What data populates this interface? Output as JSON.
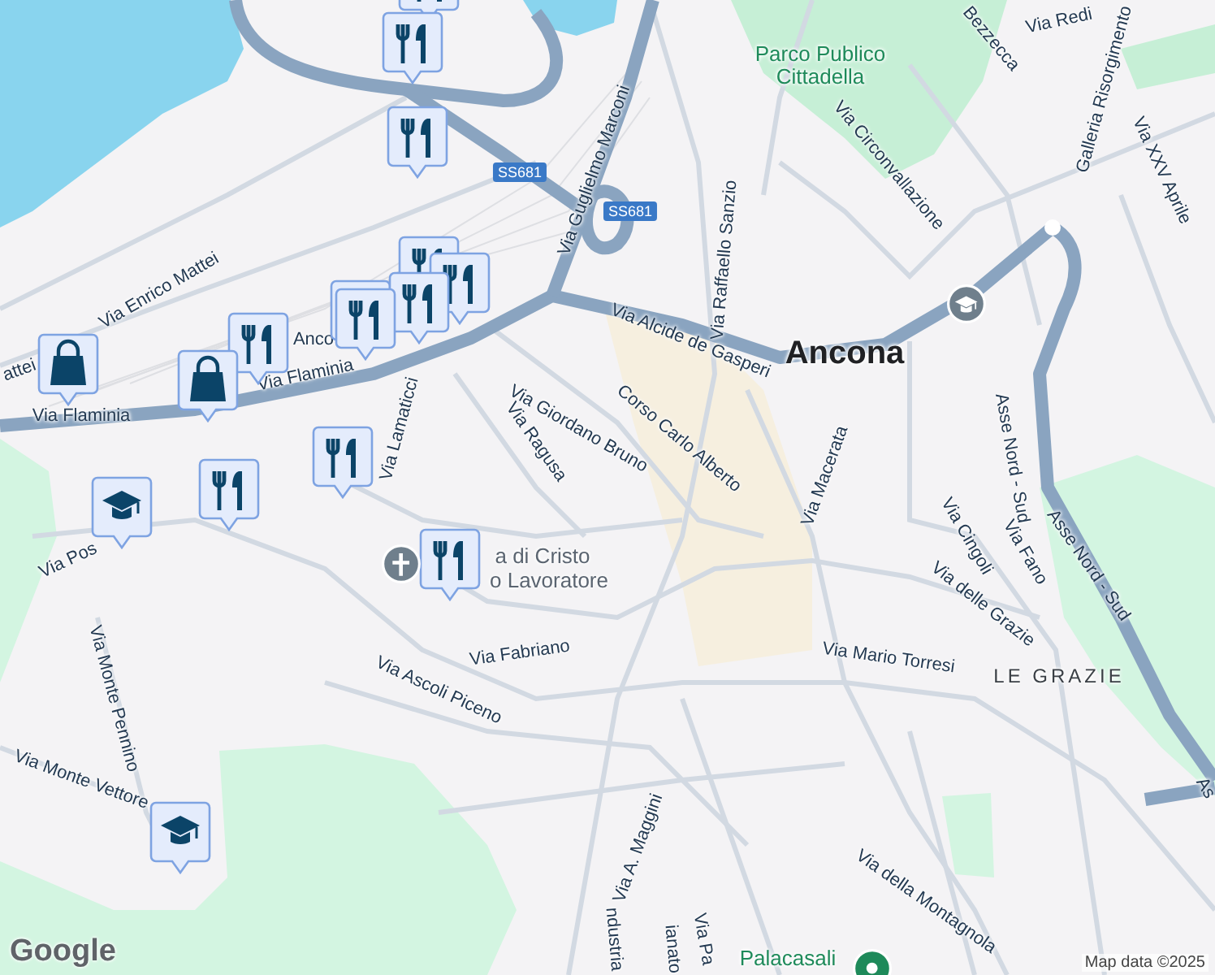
{
  "map": {
    "labels": [
      {
        "text": "Parco Publico Cittadella",
        "kind": "park"
      },
      {
        "text": "Bezzecca",
        "kind": "street"
      },
      {
        "text": "Via Redi",
        "kind": "street"
      },
      {
        "text": "Via Circonvallazione",
        "kind": "street"
      },
      {
        "text": "Galleria Risorgimento",
        "kind": "street"
      },
      {
        "text": "Via XXV Aprile",
        "kind": "street"
      },
      {
        "text": "SS681",
        "kind": "route"
      },
      {
        "text": "SS681",
        "kind": "route"
      },
      {
        "text": "Via Guglielmo Marconi",
        "kind": "street"
      },
      {
        "text": "Via Raffaello Sanzio",
        "kind": "street"
      },
      {
        "text": "Via Alcide de Gasperi",
        "kind": "street"
      },
      {
        "text": "Ancona",
        "kind": "city"
      },
      {
        "text": "Via Enrico Mattei",
        "kind": "street"
      },
      {
        "text": "attei",
        "kind": "street"
      },
      {
        "text": "Anco",
        "kind": "street"
      },
      {
        "text": "Via Flaminia",
        "kind": "street"
      },
      {
        "text": "Via Flaminia",
        "kind": "street"
      },
      {
        "text": "Via Lamaticci",
        "kind": "street"
      },
      {
        "text": "Via Giordano Bruno",
        "kind": "street"
      },
      {
        "text": "Via Ragusa",
        "kind": "street"
      },
      {
        "text": "Corso Carlo Alberto",
        "kind": "street"
      },
      {
        "text": "Via Macerata",
        "kind": "street"
      },
      {
        "text": "Asse Nord - Sud",
        "kind": "street"
      },
      {
        "text": "Asse Nord - Sud",
        "kind": "street"
      },
      {
        "text": "As",
        "kind": "street"
      },
      {
        "text": "Via Cingoli",
        "kind": "street"
      },
      {
        "text": "Via Fano",
        "kind": "street"
      },
      {
        "text": "Via delle Grazie",
        "kind": "street"
      },
      {
        "text": "Via Mario Torresi",
        "kind": "street"
      },
      {
        "text": "LE GRAZIE",
        "kind": "district"
      },
      {
        "text": "Via della Montagnola",
        "kind": "street"
      },
      {
        "text": "a di Cristo",
        "kind": "poi"
      },
      {
        "text": "o Lavoratore",
        "kind": "poi"
      },
      {
        "text": "Via Pos",
        "kind": "street"
      },
      {
        "text": "Via Monte Pennino",
        "kind": "street"
      },
      {
        "text": "Via Monte Vettore",
        "kind": "street"
      },
      {
        "text": "Via Fabriano",
        "kind": "street"
      },
      {
        "text": "Via Ascoli Piceno",
        "kind": "street"
      },
      {
        "text": "Via A. Maggini",
        "kind": "street"
      },
      {
        "text": "ndustria",
        "kind": "street"
      },
      {
        "text": "ianato",
        "kind": "street"
      },
      {
        "text": "Via Pa",
        "kind": "street"
      },
      {
        "text": "Palacasali",
        "kind": "park"
      }
    ],
    "markers": [
      {
        "kind": "restaurant"
      },
      {
        "kind": "restaurant"
      },
      {
        "kind": "restaurant"
      },
      {
        "kind": "restaurant"
      },
      {
        "kind": "restaurant"
      },
      {
        "kind": "restaurant"
      },
      {
        "kind": "restaurant"
      },
      {
        "kind": "restaurant"
      },
      {
        "kind": "restaurant"
      },
      {
        "kind": "restaurant"
      },
      {
        "kind": "restaurant"
      },
      {
        "kind": "restaurant"
      },
      {
        "kind": "shopping"
      },
      {
        "kind": "shopping"
      },
      {
        "kind": "school"
      },
      {
        "kind": "school"
      },
      {
        "kind": "school-dot"
      },
      {
        "kind": "church-dot"
      },
      {
        "kind": "park-dot"
      }
    ],
    "logo": "Google",
    "attribution": "Map data ©2025"
  }
}
